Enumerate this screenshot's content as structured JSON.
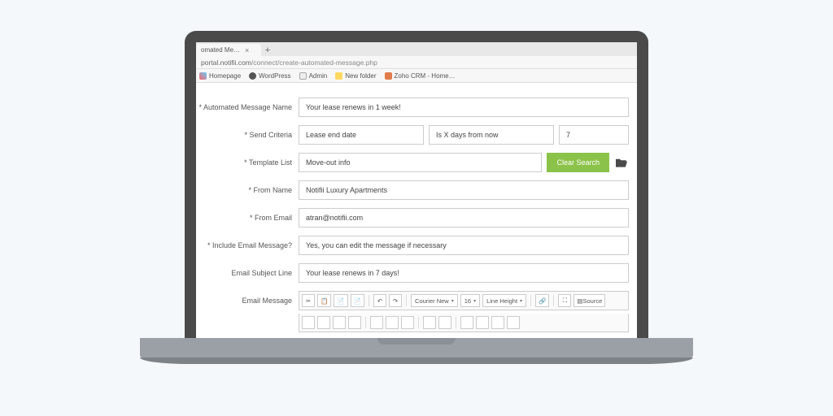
{
  "browser": {
    "tab_title": "omated Me…",
    "url_host": "portal.notifii.com",
    "url_path": "/connect/create-automated-message.php",
    "bookmarks": [
      "Homepage",
      "WordPress",
      "Admin",
      "New folder",
      "Zoho CRM - Home…"
    ]
  },
  "form": {
    "name_label": "* Automated Message Name",
    "name_value": "Your lease renews in 1 week!",
    "criteria_label": "* Send Criteria",
    "criteria_field": "Lease end date",
    "criteria_op": "Is X days from now",
    "criteria_num": "7",
    "template_label": "* Template List",
    "template_value": "Move-out info",
    "clear_search": "Clear Search",
    "from_name_label": "* From Name",
    "from_name_value": "Notifii Luxury Apartments",
    "from_email_label": "* From Email",
    "from_email_value": "atran@notifii.com",
    "include_label": "* Include Email Message?",
    "include_value": "Yes, you can edit the message if necessary",
    "subject_label": "Email Subject Line",
    "subject_value": "Your lease renews in 7 days!",
    "message_label": "Email Message"
  },
  "toolbar": {
    "font": "Courier New",
    "size": "16",
    "lineheight": "Line Height",
    "source": "Source"
  }
}
